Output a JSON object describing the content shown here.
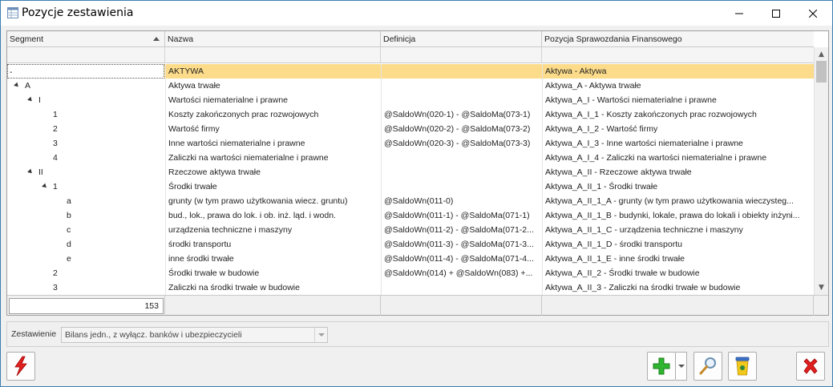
{
  "window": {
    "title": "Pozycje zestawienia"
  },
  "grid": {
    "columns": [
      "Segment",
      "Nazwa",
      "Definicja",
      "Pozycja Sprawozdania Finansowego"
    ],
    "rows": [
      {
        "segment": "-",
        "nazwa": "AKTYWA",
        "definicja": "",
        "pozycja": "Aktywa - Aktywa"
      },
      {
        "segment": "A",
        "nazwa": "Aktywa trwałe",
        "definicja": "",
        "pozycja": "Aktywa_A - Aktywa trwałe"
      },
      {
        "segment": "I",
        "nazwa": "Wartości niematerialne i prawne",
        "definicja": "",
        "pozycja": "Aktywa_A_I - Wartości niematerialne i prawne"
      },
      {
        "segment": "1",
        "nazwa": "Koszty zakończonych prac rozwojowych",
        "definicja": "@SaldoWn(020-1) - @SaldoMa(073-1)",
        "pozycja": "Aktywa_A_I_1 - Koszty zakończonych prac rozwojowych"
      },
      {
        "segment": "2",
        "nazwa": "Wartość firmy",
        "definicja": "@SaldoWn(020-2) - @SaldoMa(073-2)",
        "pozycja": "Aktywa_A_I_2 - Wartość firmy"
      },
      {
        "segment": "3",
        "nazwa": "Inne wartości niematerialne i prawne",
        "definicja": "@SaldoWn(020-3) - @SaldoMa(073-3)",
        "pozycja": "Aktywa_A_I_3 - Inne wartości niematerialne i prawne"
      },
      {
        "segment": "4",
        "nazwa": "Zaliczki na wartości niematerialne i prawne",
        "definicja": "",
        "pozycja": "Aktywa_A_I_4 - Zaliczki na wartości niematerialne i prawne"
      },
      {
        "segment": "II",
        "nazwa": "Rzeczowe aktywa trwałe",
        "definicja": "",
        "pozycja": "Aktywa_A_II - Rzeczowe aktywa trwałe"
      },
      {
        "segment": "1",
        "nazwa": "Środki trwałe",
        "definicja": "",
        "pozycja": "Aktywa_A_II_1 - Środki trwałe"
      },
      {
        "segment": "a",
        "nazwa": "grunty (w tym prawo użytkowania wiecz. gruntu)",
        "definicja": "@SaldoWn(011-0)",
        "pozycja": "Aktywa_A_II_1_A - grunty (w tym prawo użytkowania wieczysteg..."
      },
      {
        "segment": "b",
        "nazwa": "bud., lok., prawa do lok. i ob. inż. ląd. i wodn.",
        "definicja": "@SaldoWn(011-1) - @SaldoMa(071-1)",
        "pozycja": "Aktywa_A_II_1_B - budynki, lokale, prawa do lokali i obiekty inżyni..."
      },
      {
        "segment": "c",
        "nazwa": "urządzenia techniczne i maszyny",
        "definicja": "@SaldoWn(011-2) - @SaldoMa(071-2...",
        "pozycja": "Aktywa_A_II_1_C - urządzenia techniczne i maszyny"
      },
      {
        "segment": "d",
        "nazwa": "środki transportu",
        "definicja": "@SaldoWn(011-3) - @SaldoMa(071-3...",
        "pozycja": "Aktywa_A_II_1_D - środki transportu"
      },
      {
        "segment": "e",
        "nazwa": "inne środki trwałe",
        "definicja": "@SaldoWn(011-4) - @SaldoMa(071-4...",
        "pozycja": "Aktywa_A_II_1_E - inne środki trwałe"
      },
      {
        "segment": "2",
        "nazwa": "Środki trwałe w budowie",
        "definicja": "@SaldoWn(014) + @SaldoWn(083) +...",
        "pozycja": "Aktywa_A_II_2 - Środki trwałe w budowie"
      },
      {
        "segment": "3",
        "nazwa": "Zaliczki na środki trwałe w budowie",
        "definicja": "",
        "pozycja": "Aktywa_A_II_3 - Zaliczki na środki trwałe w budowie"
      }
    ],
    "count": "153"
  },
  "zestawienie": {
    "label": "Zestawienie",
    "value": "Bilans jedn., z wyłącz. banków i ubezpieczycieli"
  },
  "icons": {
    "app": "table-icon",
    "lightning": "lightning-icon",
    "add": "plus-icon",
    "edit": "magnifier-icon",
    "delete": "trash-icon",
    "close": "red-x-icon"
  },
  "colors": {
    "selected_row": "#fcdc8a",
    "window_border": "#3c7fb1"
  }
}
